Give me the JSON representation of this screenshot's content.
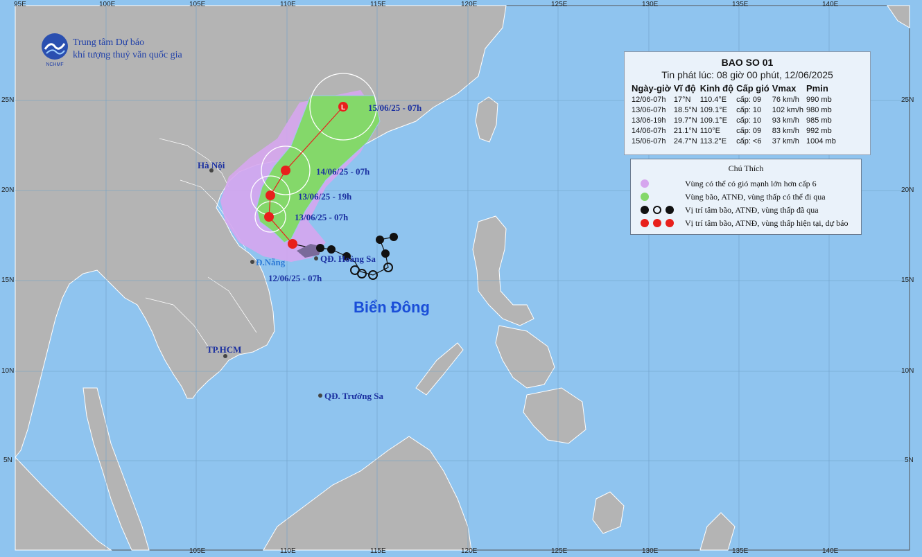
{
  "agency": {
    "line1": "Trung tâm Dự báo",
    "line2": "khí tượng thuỷ văn quốc gia",
    "logo_text": "NCHMF"
  },
  "axes": {
    "lon_top": [
      "95E",
      "100E",
      "105E",
      "110E",
      "115E",
      "120E",
      "125E",
      "130E",
      "135E",
      "140E"
    ],
    "lon_bottom": [
      "105E",
      "110E",
      "115E",
      "120E",
      "125E",
      "130E",
      "135E",
      "140E"
    ],
    "lat_left": [
      "25N",
      "20N",
      "15N",
      "10N",
      "5N"
    ],
    "lat_right": [
      "25N",
      "20N",
      "15N",
      "10N",
      "5N"
    ]
  },
  "places": {
    "hanoi": "Hà Nội",
    "danang": "Đ.Nẵng",
    "hcm": "TP.HCM",
    "hoangsa": "QĐ. Hoàng Sa",
    "truongsa": "QĐ. Trường Sa"
  },
  "sea_name": "Biển Đông",
  "track_labels": {
    "t1": "12/06/25 - 07h",
    "t2": "13/06/25 - 07h",
    "t3": "13/06/25 - 19h",
    "t4": "14/06/25 - 07h",
    "t5": "15/06/25 - 07h"
  },
  "bulletin": {
    "title": "BAO SO 01",
    "issued": "Tin phát lúc: 08 giờ 00 phút, 12/06/2025",
    "columns": [
      "Ngày-giờ",
      "Vĩ độ",
      "Kinh độ",
      "Cấp gió",
      "Vmax",
      "Pmin"
    ],
    "rows": [
      [
        "12/06-07h",
        "17°N",
        "110.4°E",
        "cấp: 09",
        "76 km/h",
        "990 mb"
      ],
      [
        "13/06-07h",
        "18.5°N",
        "109.1°E",
        "cấp: 10",
        "102 km/h",
        "980 mb"
      ],
      [
        "13/06-19h",
        "19.7°N",
        "109.1°E",
        "cấp: 10",
        "93 km/h",
        "985 mb"
      ],
      [
        "14/06-07h",
        "21.1°N",
        "110°E",
        "cấp: 09",
        "83 km/h",
        "992 mb"
      ],
      [
        "15/06-07h",
        "24.7°N",
        "113.2°E",
        "cấp: <6",
        "37 km/h",
        "1004 mb"
      ]
    ]
  },
  "legend": {
    "title": "Chú Thích",
    "items": [
      "Vùng có thể có gió mạnh lớn hơn cấp 6",
      "Vùng bão, ATNĐ, vùng thấp có thể đi qua",
      "Vị trí tâm bão, ATNĐ, vùng thấp đã qua",
      "Vị trí tâm bão, ATNĐ, vùng thấp hiện tại, dự báo"
    ]
  },
  "colors": {
    "sea": "#8fc4ef",
    "land": "#b4b4b4",
    "strong_wind_zone": "#d6a6ee",
    "storm_zone": "#84d86a",
    "current_symbol": "#e8201c",
    "past_symbol": "#111111",
    "label_blue": "#1a2fa0"
  },
  "symbols": {
    "low": "L"
  }
}
